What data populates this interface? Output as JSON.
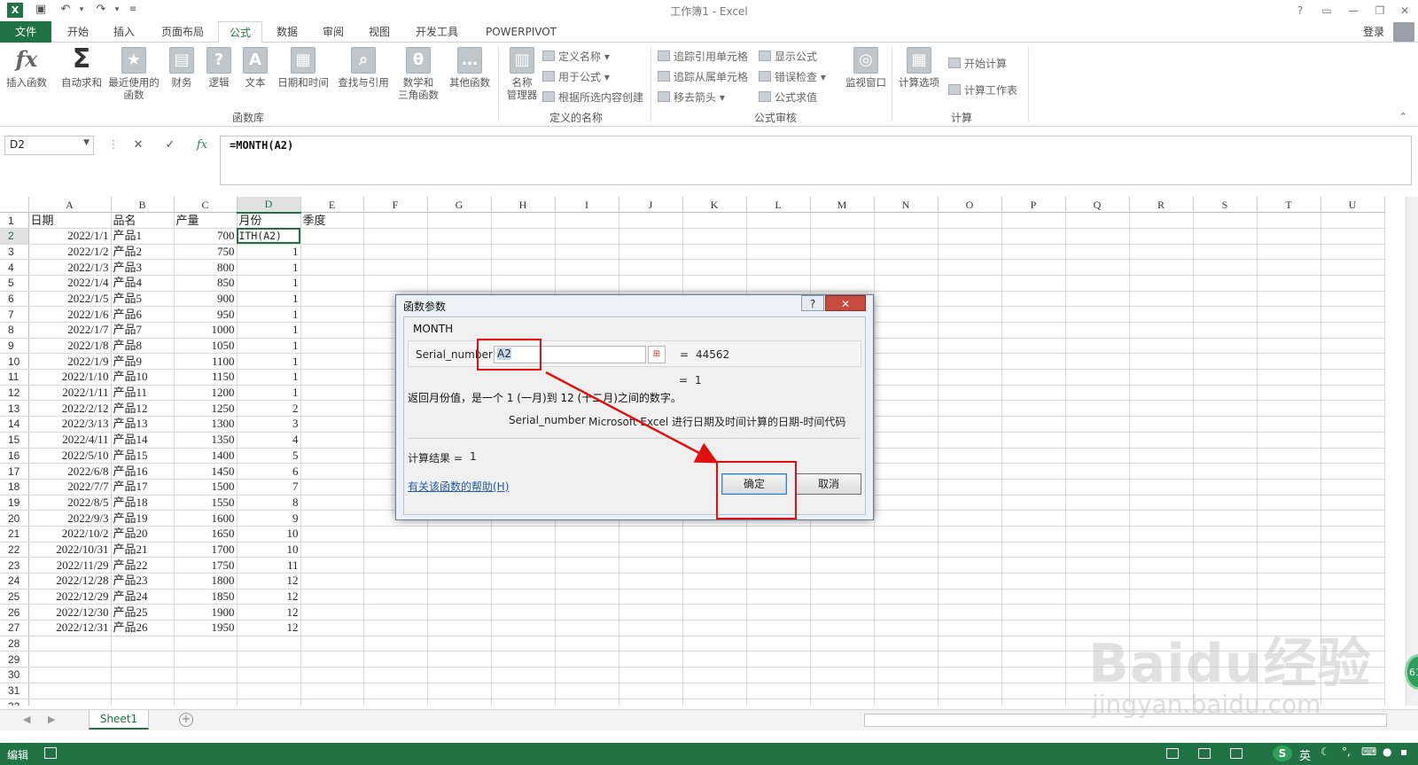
{
  "window": {
    "title": "工作簿1 - Excel",
    "logo": "X",
    "controls": [
      "?",
      "▭",
      "—",
      "❐",
      "✕"
    ]
  },
  "tabs": {
    "file": "文件",
    "items": [
      "开始",
      "插入",
      "页面布局",
      "公式",
      "数据",
      "审阅",
      "视图",
      "开发工具",
      "POWERPIVOT"
    ],
    "active_index": 3,
    "login": "登录"
  },
  "ribbon": {
    "insert_function": "插入函数",
    "autosum": "自动求和",
    "recent_1": "最近使用的",
    "recent_2": "函数",
    "financial": "财务",
    "logical": "逻辑",
    "text": "文本",
    "datetime": "日期和时间",
    "lookup": "查找与引用",
    "math_1": "数学和",
    "math_2": "三角函数",
    "more": "其他函数",
    "group_library": "函数库",
    "name_manager_1": "名称",
    "name_manager_2": "管理器",
    "define_name": "定义名称",
    "use_in_formula": "用于公式",
    "create_from_selection": "根据所选内容创建",
    "group_names": "定义的名称",
    "trace_precedents": "追踪引用单元格",
    "trace_dependents": "追踪从属单元格",
    "remove_arrows": "移去箭头",
    "show_formulas": "显示公式",
    "error_checking": "错误检查",
    "evaluate_formula": "公式求值",
    "watch_window": "监视窗口",
    "group_audit": "公式审核",
    "calc_options": "计算选项",
    "calc_now": "开始计算",
    "calc_sheet": "计算工作表",
    "group_calc": "计算"
  },
  "formula_bar": {
    "name_box": "D2",
    "formula": "=MONTH(A2)"
  },
  "grid": {
    "columns": [
      "A",
      "B",
      "C",
      "D",
      "E",
      "F",
      "G",
      "H",
      "I",
      "J",
      "K",
      "L",
      "M",
      "N",
      "O",
      "P",
      "Q",
      "R",
      "S",
      "T",
      "U"
    ],
    "header_row": [
      "日期",
      "品名",
      "产量",
      "月份",
      "季度"
    ],
    "rows": [
      [
        "2022/1/1",
        "产品1",
        "700",
        "ITH(A2)"
      ],
      [
        "2022/1/2",
        "产品2",
        "750",
        "1"
      ],
      [
        "2022/1/3",
        "产品3",
        "800",
        "1"
      ],
      [
        "2022/1/4",
        "产品4",
        "850",
        "1"
      ],
      [
        "2022/1/5",
        "产品5",
        "900",
        "1"
      ],
      [
        "2022/1/6",
        "产品6",
        "950",
        "1"
      ],
      [
        "2022/1/7",
        "产品7",
        "1000",
        "1"
      ],
      [
        "2022/1/8",
        "产品8",
        "1050",
        "1"
      ],
      [
        "2022/1/9",
        "产品9",
        "1100",
        "1"
      ],
      [
        "2022/1/10",
        "产品10",
        "1150",
        "1"
      ],
      [
        "2022/1/11",
        "产品11",
        "1200",
        "1"
      ],
      [
        "2022/2/12",
        "产品12",
        "1250",
        "2"
      ],
      [
        "2022/3/13",
        "产品13",
        "1300",
        "3"
      ],
      [
        "2022/4/11",
        "产品14",
        "1350",
        "4"
      ],
      [
        "2022/5/10",
        "产品15",
        "1400",
        "5"
      ],
      [
        "2022/6/8",
        "产品16",
        "1450",
        "6"
      ],
      [
        "2022/7/7",
        "产品17",
        "1500",
        "7"
      ],
      [
        "2022/8/5",
        "产品18",
        "1550",
        "8"
      ],
      [
        "2022/9/3",
        "产品19",
        "1600",
        "9"
      ],
      [
        "2022/10/2",
        "产品20",
        "1650",
        "10"
      ],
      [
        "2022/10/31",
        "产品21",
        "1700",
        "10"
      ],
      [
        "2022/11/29",
        "产品22",
        "1750",
        "11"
      ],
      [
        "2022/12/28",
        "产品23",
        "1800",
        "12"
      ],
      [
        "2022/12/29",
        "产品24",
        "1850",
        "12"
      ],
      [
        "2022/12/30",
        "产品25",
        "1900",
        "12"
      ],
      [
        "2022/12/31",
        "产品26",
        "1950",
        "12"
      ]
    ],
    "row_numbers": [
      "1",
      "2",
      "3",
      "4",
      "5",
      "6",
      "7",
      "8",
      "9",
      "10",
      "11",
      "12",
      "13",
      "14",
      "15",
      "16",
      "17",
      "18",
      "19",
      "20",
      "21",
      "22",
      "23",
      "24",
      "25",
      "26",
      "27",
      "28",
      "29",
      "30",
      "31",
      "32"
    ]
  },
  "sheets": {
    "active": "Sheet1",
    "add": "+"
  },
  "status": {
    "mode": "编辑",
    "ime": "英"
  },
  "dialog": {
    "title": "函数参数",
    "function_name": "MONTH",
    "arg_label": "Serial_number",
    "arg_value": "A2",
    "arg_result_eq": "=",
    "arg_result": "44562",
    "result_eq": "=",
    "result": "1",
    "description": "返回月份值，是一个 1 (一月)到 12 (十二月)之间的数字。",
    "arg_desc_label": "Serial_number",
    "arg_desc": "Microsoft Excel 进行日期及时间计算的日期-时间代码",
    "calc_label": "计算结果 =",
    "calc_value": "1",
    "help_link": "有关该函数的帮助(H)",
    "ok": "确定",
    "cancel": "取消"
  },
  "watermark": {
    "brand": "Baidu经验",
    "url": "jingyan.baidu.com",
    "badge": "61"
  },
  "colors": {
    "excel_green": "#217346",
    "annotation_red": "#e01010"
  }
}
